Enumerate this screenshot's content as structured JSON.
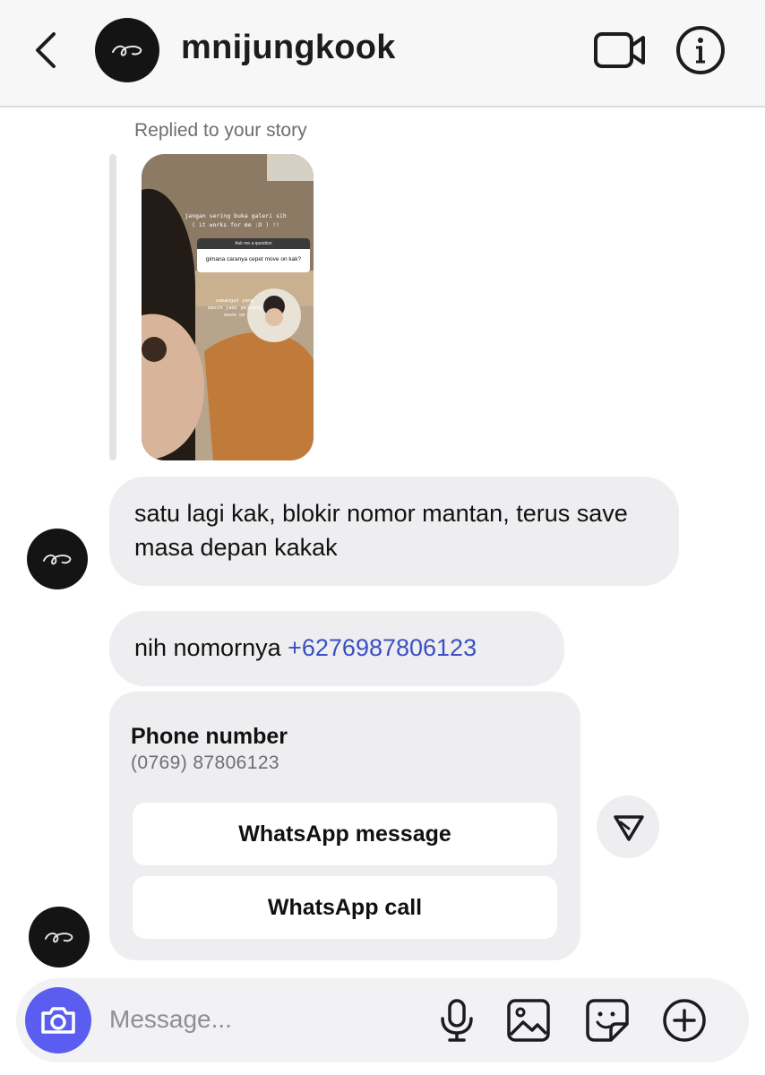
{
  "header": {
    "username": "mnijungkook",
    "back_icon": "chevron-left-icon",
    "video_icon": "video-camera-icon",
    "info_icon": "info-icon"
  },
  "story_reply": {
    "label": "Replied to your story",
    "caption_line1": "jangan sering buka galeri sih",
    "caption_line2": "( it works for me :D ) !!",
    "question_header": "Ask me a question",
    "question_text": "gimana caranya cepet move on kak?",
    "sub_caption": "semangat yang masih jadi pejuang move on"
  },
  "messages": [
    {
      "text": "satu lagi kak, blokir nomor mantan, terus save masa depan kakak"
    },
    {
      "text": "nih nomornya ",
      "link": "+6276987806123"
    }
  ],
  "phone_card": {
    "title": "Phone number",
    "number": "(0769) 87806123",
    "whatsapp_message_label": "WhatsApp message",
    "whatsapp_call_label": "WhatsApp call"
  },
  "composer": {
    "placeholder": "Message...",
    "camera_icon": "camera-icon",
    "mic_icon": "microphone-icon",
    "gallery_icon": "image-icon",
    "sticker_icon": "sticker-icon",
    "plus_icon": "plus-circle-icon"
  },
  "colors": {
    "accent": "#5b5cf0",
    "link": "#3b4fc4",
    "bubble": "#eeeef0",
    "header_bg": "#f7f7f8"
  }
}
